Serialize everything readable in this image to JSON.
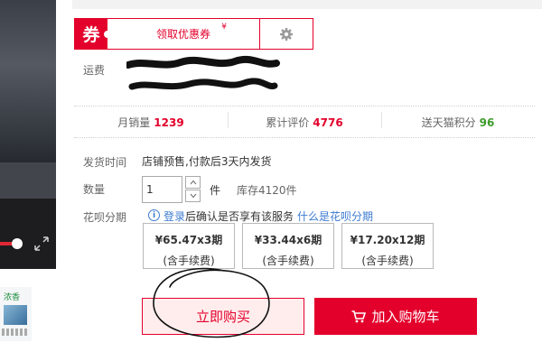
{
  "coupon": {
    "tag": "券",
    "claim_label": "领取优惠券",
    "yen_mark": "¥"
  },
  "shipping": {
    "label": "运费"
  },
  "stats": [
    {
      "label": "月销量",
      "value": "1239",
      "color": "#e3002b"
    },
    {
      "label": "累计评价",
      "value": "4776",
      "color": "#e3002b"
    },
    {
      "label": "送天猫积分",
      "value": "96",
      "color": "#3c9b2a"
    }
  ],
  "delivery": {
    "label": "发货时间",
    "text": "店铺预售,付款后3天内发货"
  },
  "quantity": {
    "label": "数量",
    "value": "1",
    "unit": "件",
    "stock": "库存4120件"
  },
  "installment": {
    "label": "花呗分期",
    "info_icon": "i",
    "login_link": "登录",
    "login_note": "后确认是否享有该服务",
    "what_link": "什么是花呗分期",
    "plans": [
      {
        "price": "¥65.47x3期",
        "fee": "(含手续费)"
      },
      {
        "price": "¥33.44x6期",
        "fee": "(含手续费)"
      },
      {
        "price": "¥17.20x12期",
        "fee": "(含手续费)"
      }
    ]
  },
  "actions": {
    "buy_now": "立即购买",
    "add_to_cart": "加入购物车"
  },
  "gallery": {
    "thumbnail_caption": "浓香"
  },
  "colors": {
    "accent": "#e3002b",
    "link": "#3c7bd0",
    "points": "#3c9b2a"
  },
  "icons": [
    "settings-gear-icon",
    "chevron-up-icon",
    "chevron-down-icon",
    "info-icon",
    "cart-icon",
    "fullscreen-icon"
  ]
}
